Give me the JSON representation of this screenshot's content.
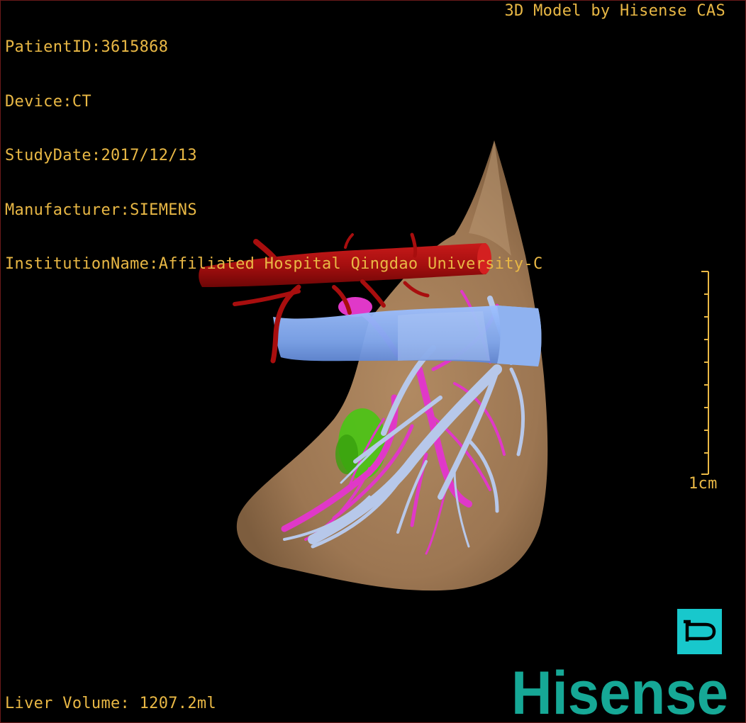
{
  "info": {
    "patient_id": "PatientID:3615868",
    "device": "Device:CT",
    "study_date": "StudyDate:2017/12/13",
    "manufacturer": "Manufacturer:SIEMENS",
    "institution": "InstitutionName:Affiliated Hospital Qingdao University-C"
  },
  "credit": "3D Model by Hisense CAS",
  "scale_bar": {
    "label": "1cm"
  },
  "liver_volume": "Liver Volume: 1207.2ml",
  "pan_tool": {
    "icon": "pan-icon",
    "accent": "#18c8cc"
  },
  "brand": {
    "name": "Hisense",
    "color": "#16a896"
  },
  "colors": {
    "text": "#e9b845",
    "liver": "#a47e58",
    "hepatic_artery": "#b01010",
    "portal_vein": "#8aa8f0",
    "hepatic_vein": "#e038c8",
    "gallbladder": "#4cc818"
  }
}
